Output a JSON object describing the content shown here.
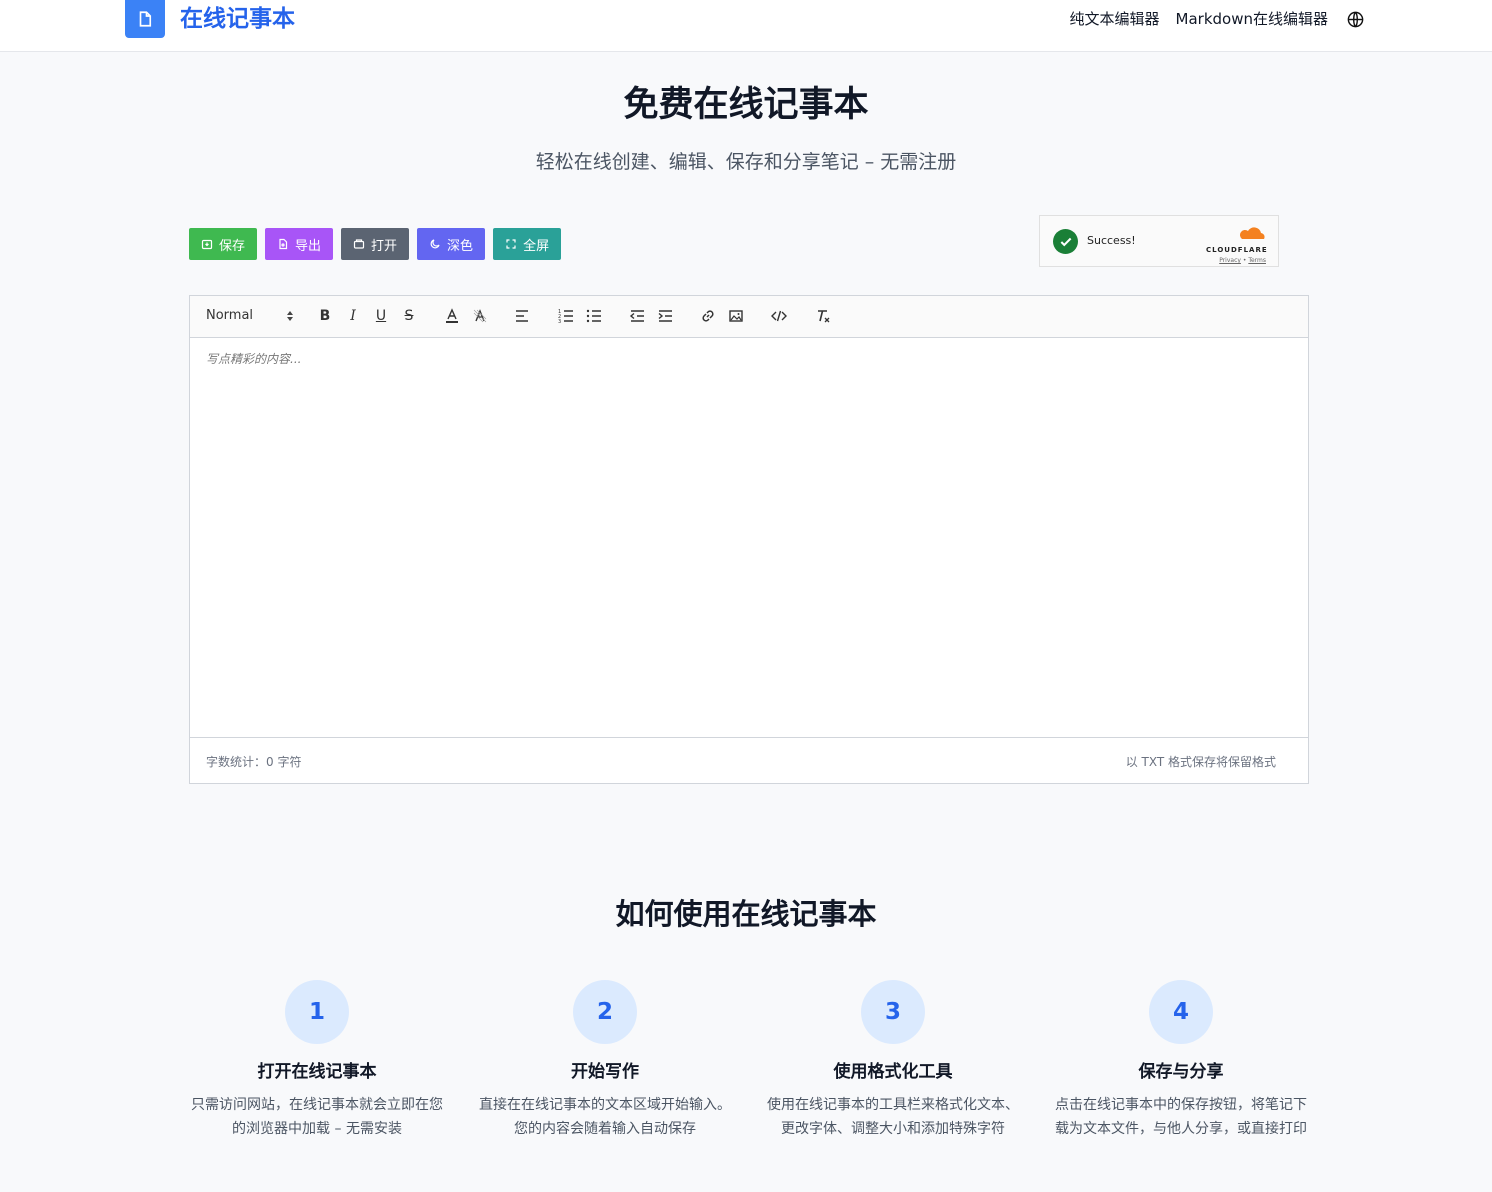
{
  "header": {
    "site_title": "在线记事本",
    "nav": {
      "plain_text": "纯文本编辑器",
      "markdown": "Markdown在线编辑器"
    }
  },
  "hero": {
    "title": "免费在线记事本",
    "subtitle": "轻松在线创建、编辑、保存和分享笔记 – 无需注册"
  },
  "actions": {
    "save": "保存",
    "export": "导出",
    "open": "打开",
    "dark": "深色",
    "fullscreen": "全屏"
  },
  "captcha": {
    "message": "Success!",
    "brand": "CLOUDFLARE",
    "privacy": "Privacy",
    "separator": "•",
    "terms": "Terms"
  },
  "editor": {
    "format_select": "Normal",
    "placeholder": "写点精彩的内容...",
    "word_count": "字数统计：0 字符",
    "save_hint": "以 TXT 格式保存将保留格式"
  },
  "howto": {
    "title": "如何使用在线记事本",
    "steps": [
      {
        "num": "1",
        "title": "打开在线记事本",
        "desc": "只需访问网站，在线记事本就会立即在您的浏览器中加载 – 无需安装"
      },
      {
        "num": "2",
        "title": "开始写作",
        "desc": "直接在在线记事本的文本区域开始输入。您的内容会随着输入自动保存"
      },
      {
        "num": "3",
        "title": "使用格式化工具",
        "desc": "使用在线记事本的工具栏来格式化文本、更改字体、调整大小和添加特殊字符"
      },
      {
        "num": "4",
        "title": "保存与分享",
        "desc": "点击在线记事本中的保存按钮，将笔记下载为文本文件，与他人分享，或直接打印"
      }
    ]
  },
  "colors": {
    "brand": "#2563eb",
    "save_btn": "#3fb950",
    "export_btn": "#a855f7",
    "open_btn": "#5b6472",
    "dark_btn": "#6366f1",
    "fullscreen_btn": "#2aa198"
  }
}
